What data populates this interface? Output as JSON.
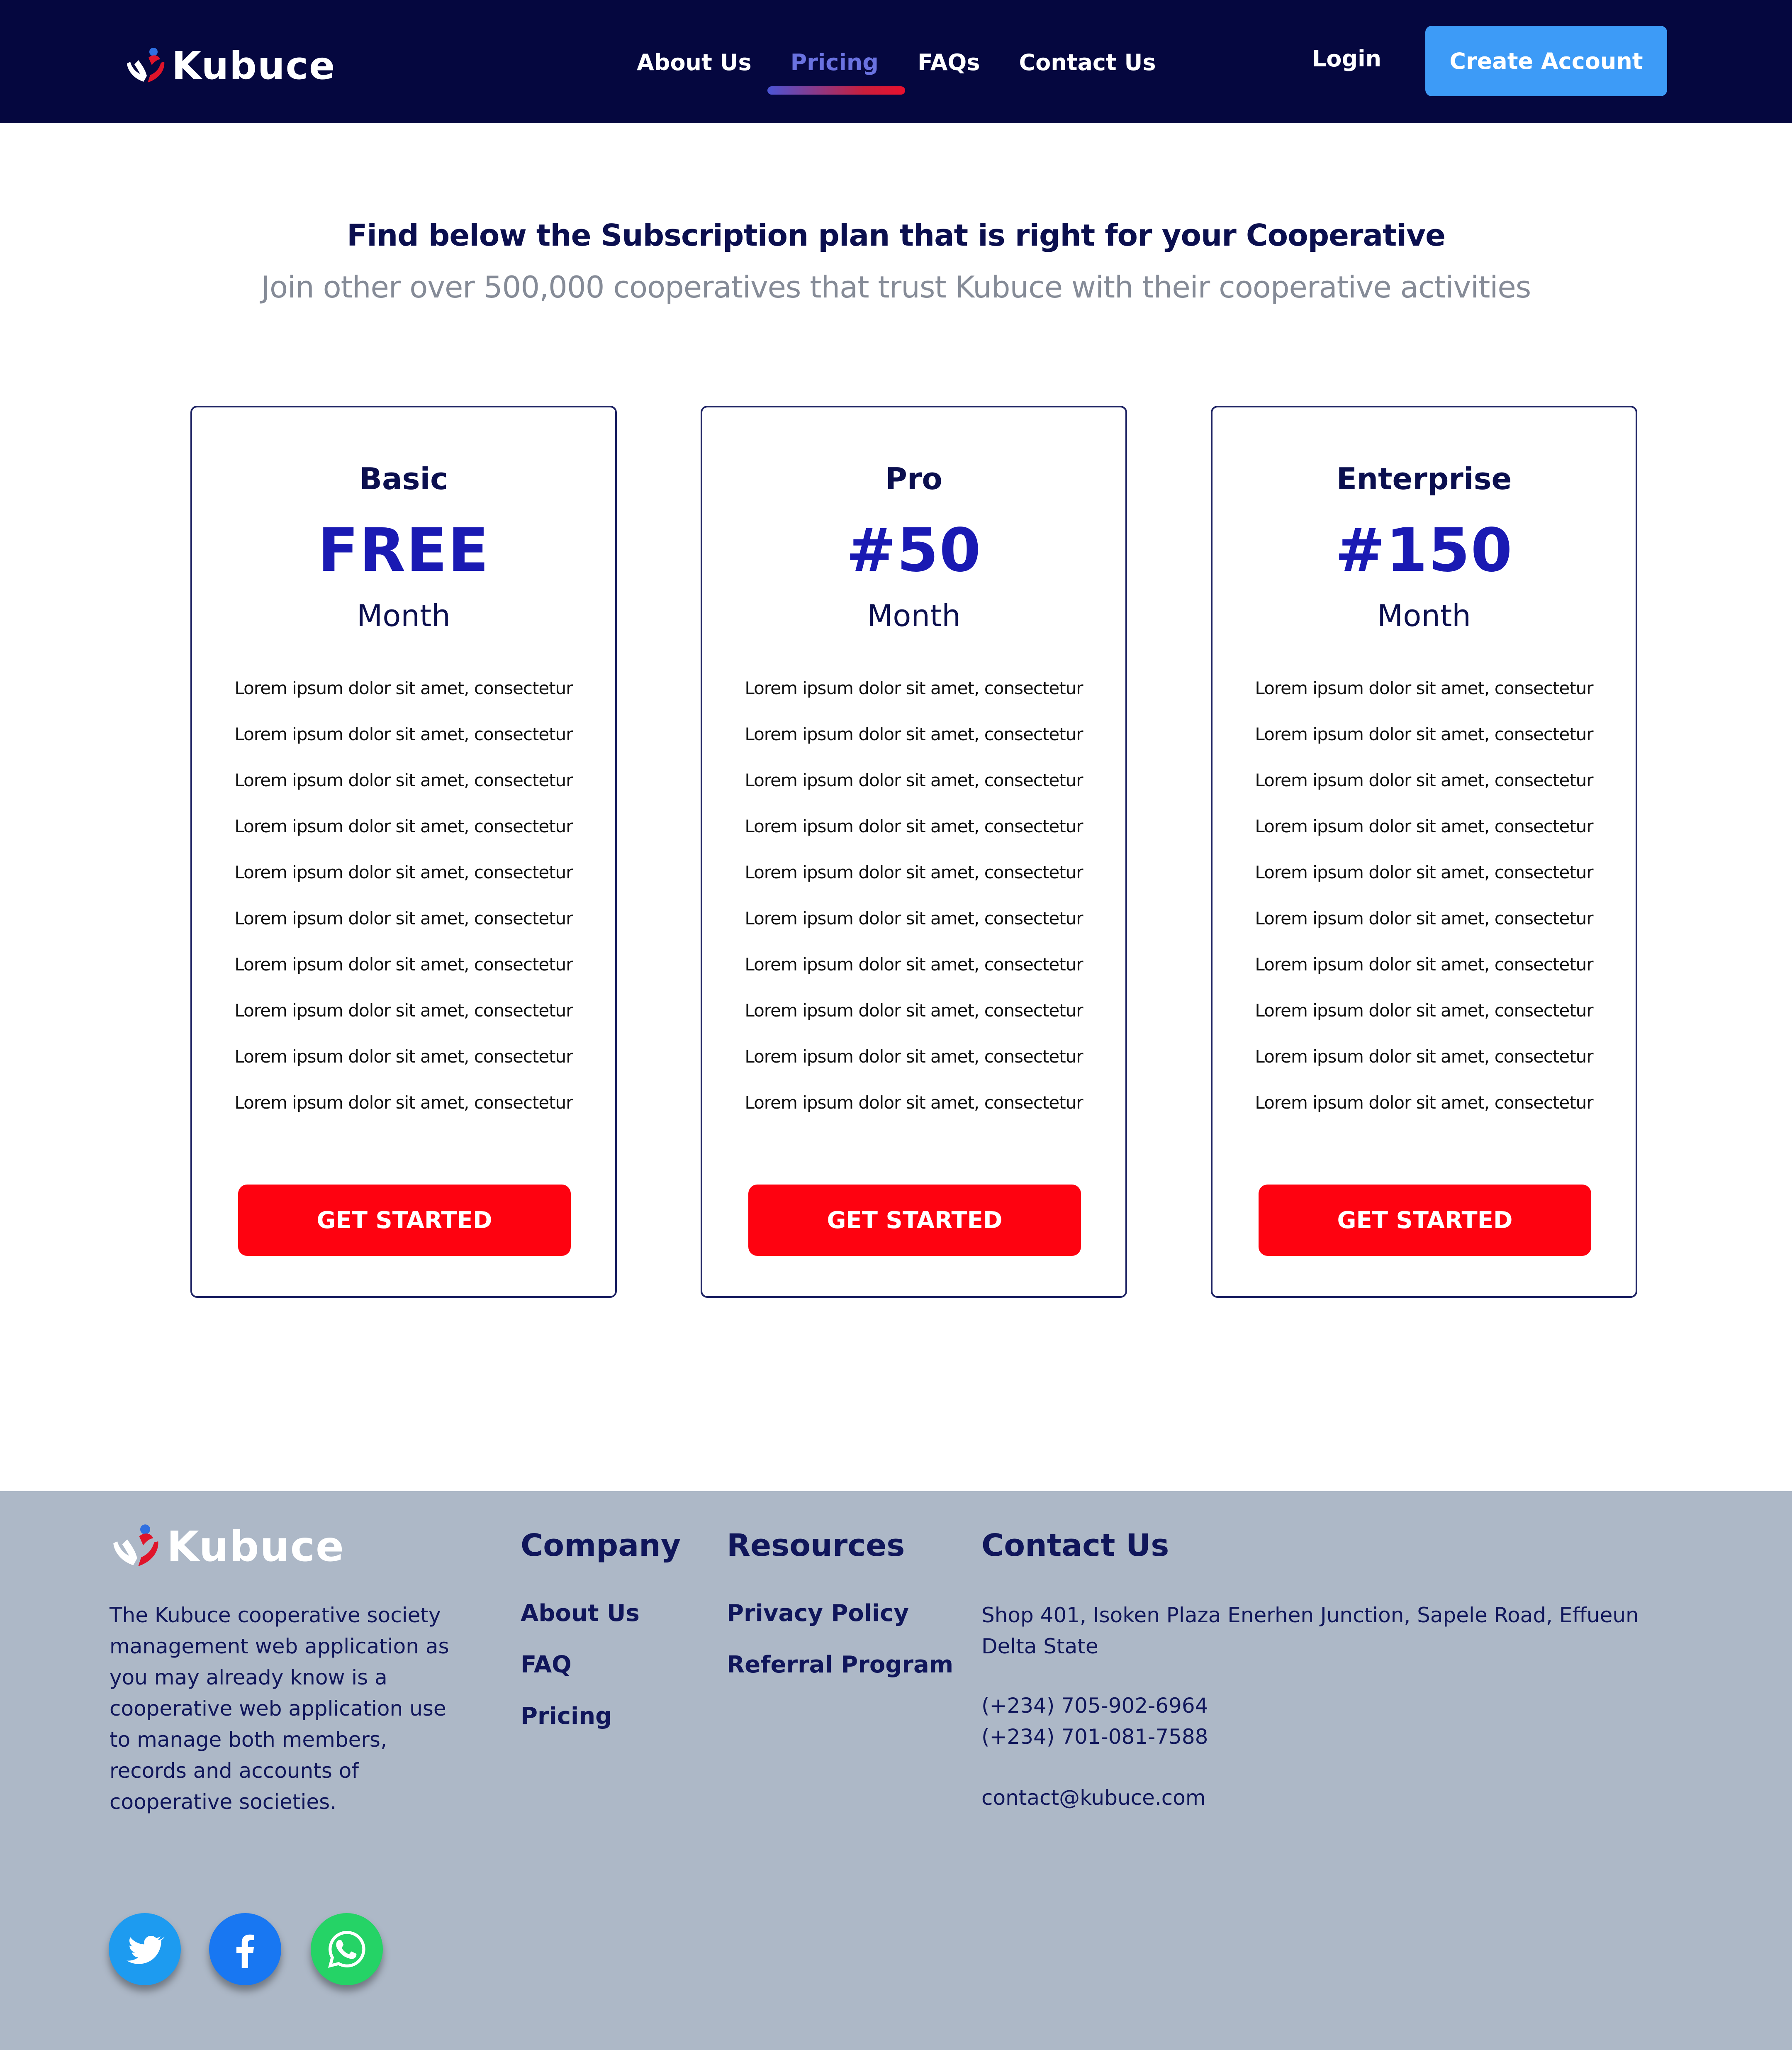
{
  "brand": {
    "name": "Kubuce"
  },
  "nav": {
    "links": [
      "About Us",
      "Pricing",
      "FAQs",
      "Contact Us"
    ],
    "active": "Pricing",
    "login": "Login",
    "create_account": "Create Account"
  },
  "hero": {
    "title": "Find below the Subscription plan that is right for your Cooperative",
    "subtitle": "Join other over 500,000 cooperatives that trust Kubuce with their cooperative activities"
  },
  "plans": [
    {
      "name": "Basic",
      "price": "FREE",
      "period": "Month",
      "features": [
        "Lorem ipsum dolor sit amet, consectetur",
        "Lorem ipsum dolor sit amet, consectetur",
        "Lorem ipsum dolor sit amet, consectetur",
        "Lorem ipsum dolor sit amet, consectetur",
        "Lorem ipsum dolor sit amet, consectetur",
        "Lorem ipsum dolor sit amet, consectetur",
        "Lorem ipsum dolor sit amet, consectetur",
        "Lorem ipsum dolor sit amet, consectetur",
        "Lorem ipsum dolor sit amet, consectetur",
        "Lorem ipsum dolor sit amet, consectetur"
      ],
      "cta": "GET STARTED"
    },
    {
      "name": "Pro",
      "price": "#50",
      "period": "Month",
      "features": [
        "Lorem ipsum dolor sit amet, consectetur",
        "Lorem ipsum dolor sit amet, consectetur",
        "Lorem ipsum dolor sit amet, consectetur",
        "Lorem ipsum dolor sit amet, consectetur",
        "Lorem ipsum dolor sit amet, consectetur",
        "Lorem ipsum dolor sit amet, consectetur",
        "Lorem ipsum dolor sit amet, consectetur",
        "Lorem ipsum dolor sit amet, consectetur",
        "Lorem ipsum dolor sit amet, consectetur",
        "Lorem ipsum dolor sit amet, consectetur"
      ],
      "cta": "GET STARTED"
    },
    {
      "name": "Enterprise",
      "price": "#150",
      "period": "Month",
      "features": [
        "Lorem ipsum dolor sit amet, consectetur",
        "Lorem ipsum dolor sit amet, consectetur",
        "Lorem ipsum dolor sit amet, consectetur",
        "Lorem ipsum dolor sit amet, consectetur",
        "Lorem ipsum dolor sit amet, consectetur",
        "Lorem ipsum dolor sit amet, consectetur",
        "Lorem ipsum dolor sit amet, consectetur",
        "Lorem ipsum dolor sit amet, consectetur",
        "Lorem ipsum dolor sit amet, consectetur",
        "Lorem ipsum dolor sit amet, consectetur"
      ],
      "cta": "GET STARTED"
    }
  ],
  "footer": {
    "about": "The Kubuce cooperative society management web application as you may already know is a cooperative web application use to manage both members, records and accounts of cooperative societies.",
    "company": {
      "heading": "Company",
      "links": [
        "About Us",
        "FAQ",
        "Pricing"
      ]
    },
    "resources": {
      "heading": "Resources",
      "links": [
        "Privacy Policy",
        "Referral Program"
      ]
    },
    "contact": {
      "heading": "Contact Us",
      "address": "Shop 401, Isoken Plaza Enerhen Junction, Sapele Road, Effueun Delta State",
      "phones": [
        "(+234) 705-902-6964",
        "(+234) 701-081-7588"
      ],
      "email": "contact@kubuce.com"
    },
    "social": [
      {
        "name": "twitter-icon",
        "color": "#1d9bf0"
      },
      {
        "name": "facebook-icon",
        "color": "#1877f2"
      },
      {
        "name": "whatsapp-icon",
        "color": "#25d366"
      }
    ]
  },
  "colors": {
    "navbar_bg": "#05073f",
    "accent_blue": "#3d9bf7",
    "price_blue": "#1a1ab3",
    "cta_red": "#fe0210",
    "footer_bg": "#adb8c7",
    "heading_navy": "#0b0f4f"
  }
}
